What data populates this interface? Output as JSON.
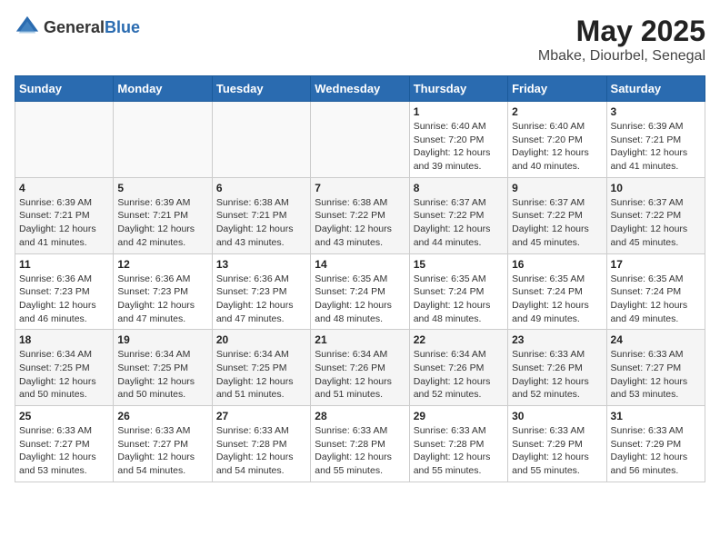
{
  "header": {
    "logo_general": "General",
    "logo_blue": "Blue",
    "title": "May 2025",
    "subtitle": "Mbake, Diourbel, Senegal"
  },
  "weekdays": [
    "Sunday",
    "Monday",
    "Tuesday",
    "Wednesday",
    "Thursday",
    "Friday",
    "Saturday"
  ],
  "weeks": [
    [
      {
        "day": "",
        "sunrise": "",
        "sunset": "",
        "daylight": ""
      },
      {
        "day": "",
        "sunrise": "",
        "sunset": "",
        "daylight": ""
      },
      {
        "day": "",
        "sunrise": "",
        "sunset": "",
        "daylight": ""
      },
      {
        "day": "",
        "sunrise": "",
        "sunset": "",
        "daylight": ""
      },
      {
        "day": "1",
        "sunrise": "Sunrise: 6:40 AM",
        "sunset": "Sunset: 7:20 PM",
        "daylight": "Daylight: 12 hours and 39 minutes."
      },
      {
        "day": "2",
        "sunrise": "Sunrise: 6:40 AM",
        "sunset": "Sunset: 7:20 PM",
        "daylight": "Daylight: 12 hours and 40 minutes."
      },
      {
        "day": "3",
        "sunrise": "Sunrise: 6:39 AM",
        "sunset": "Sunset: 7:21 PM",
        "daylight": "Daylight: 12 hours and 41 minutes."
      }
    ],
    [
      {
        "day": "4",
        "sunrise": "Sunrise: 6:39 AM",
        "sunset": "Sunset: 7:21 PM",
        "daylight": "Daylight: 12 hours and 41 minutes."
      },
      {
        "day": "5",
        "sunrise": "Sunrise: 6:39 AM",
        "sunset": "Sunset: 7:21 PM",
        "daylight": "Daylight: 12 hours and 42 minutes."
      },
      {
        "day": "6",
        "sunrise": "Sunrise: 6:38 AM",
        "sunset": "Sunset: 7:21 PM",
        "daylight": "Daylight: 12 hours and 43 minutes."
      },
      {
        "day": "7",
        "sunrise": "Sunrise: 6:38 AM",
        "sunset": "Sunset: 7:22 PM",
        "daylight": "Daylight: 12 hours and 43 minutes."
      },
      {
        "day": "8",
        "sunrise": "Sunrise: 6:37 AM",
        "sunset": "Sunset: 7:22 PM",
        "daylight": "Daylight: 12 hours and 44 minutes."
      },
      {
        "day": "9",
        "sunrise": "Sunrise: 6:37 AM",
        "sunset": "Sunset: 7:22 PM",
        "daylight": "Daylight: 12 hours and 45 minutes."
      },
      {
        "day": "10",
        "sunrise": "Sunrise: 6:37 AM",
        "sunset": "Sunset: 7:22 PM",
        "daylight": "Daylight: 12 hours and 45 minutes."
      }
    ],
    [
      {
        "day": "11",
        "sunrise": "Sunrise: 6:36 AM",
        "sunset": "Sunset: 7:23 PM",
        "daylight": "Daylight: 12 hours and 46 minutes."
      },
      {
        "day": "12",
        "sunrise": "Sunrise: 6:36 AM",
        "sunset": "Sunset: 7:23 PM",
        "daylight": "Daylight: 12 hours and 47 minutes."
      },
      {
        "day": "13",
        "sunrise": "Sunrise: 6:36 AM",
        "sunset": "Sunset: 7:23 PM",
        "daylight": "Daylight: 12 hours and 47 minutes."
      },
      {
        "day": "14",
        "sunrise": "Sunrise: 6:35 AM",
        "sunset": "Sunset: 7:24 PM",
        "daylight": "Daylight: 12 hours and 48 minutes."
      },
      {
        "day": "15",
        "sunrise": "Sunrise: 6:35 AM",
        "sunset": "Sunset: 7:24 PM",
        "daylight": "Daylight: 12 hours and 48 minutes."
      },
      {
        "day": "16",
        "sunrise": "Sunrise: 6:35 AM",
        "sunset": "Sunset: 7:24 PM",
        "daylight": "Daylight: 12 hours and 49 minutes."
      },
      {
        "day": "17",
        "sunrise": "Sunrise: 6:35 AM",
        "sunset": "Sunset: 7:24 PM",
        "daylight": "Daylight: 12 hours and 49 minutes."
      }
    ],
    [
      {
        "day": "18",
        "sunrise": "Sunrise: 6:34 AM",
        "sunset": "Sunset: 7:25 PM",
        "daylight": "Daylight: 12 hours and 50 minutes."
      },
      {
        "day": "19",
        "sunrise": "Sunrise: 6:34 AM",
        "sunset": "Sunset: 7:25 PM",
        "daylight": "Daylight: 12 hours and 50 minutes."
      },
      {
        "day": "20",
        "sunrise": "Sunrise: 6:34 AM",
        "sunset": "Sunset: 7:25 PM",
        "daylight": "Daylight: 12 hours and 51 minutes."
      },
      {
        "day": "21",
        "sunrise": "Sunrise: 6:34 AM",
        "sunset": "Sunset: 7:26 PM",
        "daylight": "Daylight: 12 hours and 51 minutes."
      },
      {
        "day": "22",
        "sunrise": "Sunrise: 6:34 AM",
        "sunset": "Sunset: 7:26 PM",
        "daylight": "Daylight: 12 hours and 52 minutes."
      },
      {
        "day": "23",
        "sunrise": "Sunrise: 6:33 AM",
        "sunset": "Sunset: 7:26 PM",
        "daylight": "Daylight: 12 hours and 52 minutes."
      },
      {
        "day": "24",
        "sunrise": "Sunrise: 6:33 AM",
        "sunset": "Sunset: 7:27 PM",
        "daylight": "Daylight: 12 hours and 53 minutes."
      }
    ],
    [
      {
        "day": "25",
        "sunrise": "Sunrise: 6:33 AM",
        "sunset": "Sunset: 7:27 PM",
        "daylight": "Daylight: 12 hours and 53 minutes."
      },
      {
        "day": "26",
        "sunrise": "Sunrise: 6:33 AM",
        "sunset": "Sunset: 7:27 PM",
        "daylight": "Daylight: 12 hours and 54 minutes."
      },
      {
        "day": "27",
        "sunrise": "Sunrise: 6:33 AM",
        "sunset": "Sunset: 7:28 PM",
        "daylight": "Daylight: 12 hours and 54 minutes."
      },
      {
        "day": "28",
        "sunrise": "Sunrise: 6:33 AM",
        "sunset": "Sunset: 7:28 PM",
        "daylight": "Daylight: 12 hours and 55 minutes."
      },
      {
        "day": "29",
        "sunrise": "Sunrise: 6:33 AM",
        "sunset": "Sunset: 7:28 PM",
        "daylight": "Daylight: 12 hours and 55 minutes."
      },
      {
        "day": "30",
        "sunrise": "Sunrise: 6:33 AM",
        "sunset": "Sunset: 7:29 PM",
        "daylight": "Daylight: 12 hours and 55 minutes."
      },
      {
        "day": "31",
        "sunrise": "Sunrise: 6:33 AM",
        "sunset": "Sunset: 7:29 PM",
        "daylight": "Daylight: 12 hours and 56 minutes."
      }
    ]
  ]
}
